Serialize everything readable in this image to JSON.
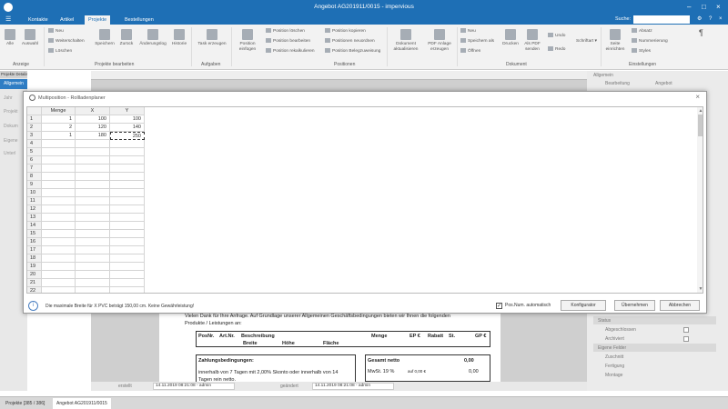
{
  "window": {
    "title": "Angebot AG201911/0015 - impervious",
    "search_label": "Suche:"
  },
  "menu": {
    "tabs": [
      "Kontakte",
      "Artikel",
      "Projekte",
      "Bestellungen"
    ],
    "active": "Projekte"
  },
  "ribbon": {
    "groups": {
      "anzeige": "Anzeige",
      "projekte": "Projekte bearbeiten",
      "aufgaben": "Aufgaben",
      "positionen": "Positionen",
      "dokument": "Dokument",
      "einstellungen": "Einstellungen"
    },
    "buttons": {
      "alle": "Alle",
      "auswahl": "Auswahl",
      "neu": "Neu",
      "weiterschalten": "Weiterschalten",
      "loeschen": "Löschen",
      "speichern": "Speichern",
      "zurueck": "Zurück",
      "aenderungslog": "Änderungslog",
      "historie": "Historie",
      "task": "Task erzeugen",
      "position_einfuegen": "Position einfügen",
      "pos_loeschen": "Position löschen",
      "pos_bearbeiten": "Position bearbeiten",
      "pos_rekalkulieren": "Position rekalkulieren",
      "pos_kopieren": "Position kopieren",
      "pos_neu": "Positionen neuordnen",
      "pos_beleg": "Position Belegzuweisung",
      "dok_aktualisieren": "Dokument aktualisieren",
      "pdf_anlage": "PDF Anlage erzeugen",
      "d_neu": "Neu",
      "speichern_als": "Speichern als",
      "oeffnen": "Öffnen",
      "drucken": "Drucken",
      "als_pdf": "Als PDF senden",
      "undo": "Undo",
      "redo": "Redo",
      "schriftart": "Schriftart",
      "seite": "Seite einrichten",
      "absatz": "Absatz",
      "nummerierung": "Nummerierung",
      "styles": "Styles"
    }
  },
  "left_panel": {
    "header": "Projekte Detailansicht",
    "selected": "Allgemein",
    "items": [
      "Jahr",
      "Projekt",
      "Dokum",
      "Eigene",
      "Unterl"
    ]
  },
  "right_panel": {
    "header": "Allgemein",
    "sub": "Bearbeitung",
    "sub2": "Angebot",
    "status": "Status",
    "abgeschlossen": "Abgeschlossen",
    "archiviert": "Archiviert",
    "eigene_felder": "Eigene Felder",
    "zuschnitt": "Zuschnitt",
    "fertigung": "Fertigung",
    "montage": "Montage"
  },
  "dialog": {
    "title": "Multiposition - Rollladenplaner",
    "columns": [
      "Menge",
      "X",
      "Y"
    ],
    "rows": [
      {
        "num": "1",
        "menge": "1",
        "x": "100",
        "y": "100"
      },
      {
        "num": "2",
        "menge": "2",
        "x": "120",
        "y": "140"
      },
      {
        "num": "3",
        "menge": "1",
        "x": "180",
        "y": "250"
      }
    ],
    "empty_rows": [
      "4",
      "5",
      "6",
      "7",
      "8",
      "9",
      "10",
      "11",
      "12",
      "13",
      "14",
      "15",
      "16",
      "17",
      "18",
      "19",
      "20",
      "21",
      "22"
    ],
    "message": "Die maximale Breite für X PVC beträgt 150,00 cm. Keine Gewährleistung!",
    "checkbox_label": "Pos.Num. automatisch",
    "checkbox_checked": "✓",
    "btn_konfigurator": "Konfigurator",
    "btn_uebernehmen": "Übernehmen",
    "btn_abbrechen": "Abbrechen"
  },
  "document": {
    "intro1": "Vielen Dank für Ihre Anfrage. Auf Grundlage unserer Allgemeinen Geschäftsbedingungen bieten wir Ihnen die folgenden",
    "intro2": "Produkte / Leistungen an:",
    "th": {
      "posnr": "PosNr.",
      "artnr": "Art.Nr.",
      "beschreibung": "Beschreibung",
      "breite": "Breite",
      "hoehe": "Höhe",
      "flaeche": "Fläche",
      "menge": "Menge",
      "ep": "EP €",
      "rabatt": "Rabatt",
      "st": "St.",
      "gp": "GP €"
    },
    "zahl_title": "Zahlungsbedingungen:",
    "zahl1": "innerhalb von 7 Tagen mit 2,00% Skonto oder innerhalb von 14",
    "zahl2": "Tagen rein netto.",
    "gesamt": "Gesamt netto",
    "gesamt_val": "0,00",
    "mwst": "MwSt. 19 %",
    "mwst_base": "auf 0,00 €",
    "mwst_val": "0,00"
  },
  "status": {
    "erstellt": "erstellt",
    "erstellt_val": "14.11.2019 08:21:08 - admin",
    "geaendert": "geändert",
    "geaendert_val": "14.11.2019 08:21:08 - admin"
  },
  "bottom_tabs": [
    "Projekte [385 / 386]",
    "Angebot AG201911/0015"
  ]
}
